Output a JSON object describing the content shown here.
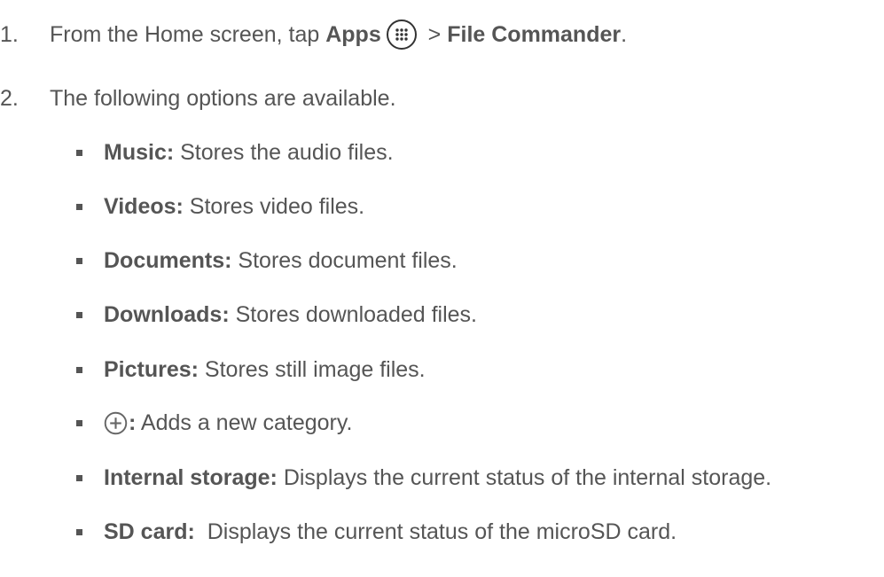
{
  "steps": [
    {
      "number": "1.",
      "prefix": "From the Home screen, tap ",
      "apps_label": "Apps",
      "separator": " > ",
      "target": "File Commander",
      "suffix": ".",
      "icon": "apps-icon"
    },
    {
      "number": "2.",
      "text": "The following options are available."
    }
  ],
  "options": [
    {
      "term": "Music:",
      "desc": " Stores the audio files."
    },
    {
      "term": "Videos:",
      "desc": " Stores video files."
    },
    {
      "term": "Documents:",
      "desc": " Stores document files."
    },
    {
      "term": "Downloads:",
      "desc": " Stores downloaded files."
    },
    {
      "term": "Pictures:",
      "desc": " Stores still image files."
    },
    {
      "term": ":",
      "desc": " Adds a new category.",
      "icon": "add-circle-icon"
    },
    {
      "term": "Internal storage:",
      "desc": " Displays the current status of the internal storage."
    },
    {
      "term": "SD card:",
      "desc": "  Displays the current status of the microSD card."
    }
  ]
}
